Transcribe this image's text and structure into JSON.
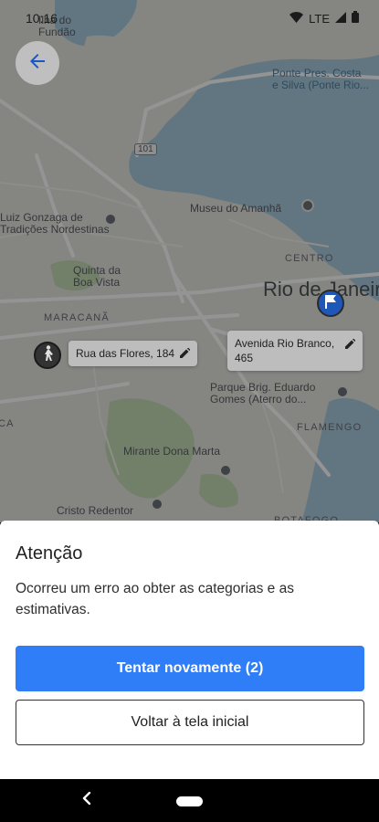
{
  "status_bar": {
    "time": "10:16",
    "network": "LTE",
    "icons": [
      "wifi-icon",
      "signal-icon",
      "battery-icon"
    ]
  },
  "map": {
    "labels": {
      "fundao": "Ilha do\nFundão",
      "ponte": "Ponte Pres. Costa\ne Silva (Ponte Rio...",
      "road_101": "101",
      "museu": "Museu do Amanhã",
      "luiz": "Luiz Gonzaga de\nTradições Nordestinas",
      "centro": "CENTRO",
      "quinta": "Quinta da\nBoa Vista",
      "rio": "Rio de Janeiro",
      "maracana": "MARACANÃ",
      "parque": "Parque Brig. Eduardo\nGomes (Aterro do...",
      "tijuca": "TIJUCA",
      "flamengo": "FLAMENGO",
      "mirante": "Mirante Dona Marta",
      "cristo": "Cristo Redentor",
      "botafogo": "BOTAFOGO"
    },
    "origin_address": "Rua das Flores, 184",
    "destination_address": "Avenida Rio Branco, 465",
    "colors": {
      "water": "#a9cbe0",
      "land": "#e6e5e0",
      "park": "#c7ddb5",
      "road": "#ffffff",
      "dest_pin": "#1e57b8"
    }
  },
  "sheet": {
    "title": "Atenção",
    "message": "Ocorreu um erro ao obter as categorias e as estimativas.",
    "primary_button": "Tentar novamente (2)",
    "secondary_button": "Voltar à tela inicial",
    "colors": {
      "primary": "#2f7ef7"
    }
  }
}
